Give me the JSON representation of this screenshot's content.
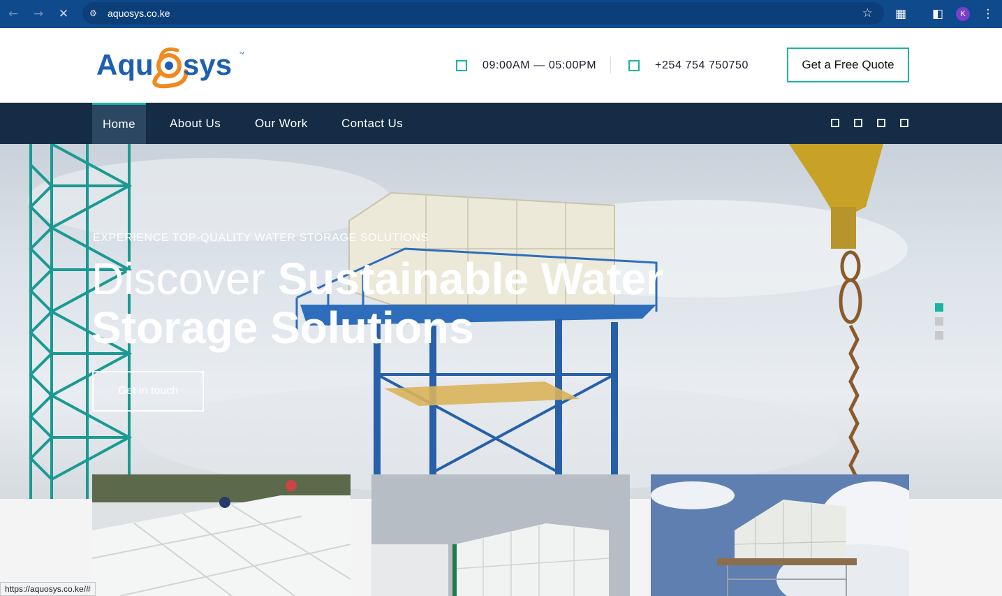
{
  "browser": {
    "url": "aquosys.co.ke",
    "status_url": "https://aquosys.co.ke/#",
    "avatar_letter": "K"
  },
  "header": {
    "logo_text": "Aquosys",
    "logo_tm": "™",
    "hours": "09:00AM — 05:00PM",
    "phone": "+254 754 750750",
    "quote_button": "Get a Free Quote"
  },
  "nav": {
    "items": [
      {
        "label": "Home",
        "active": true
      },
      {
        "label": "About Us",
        "active": false
      },
      {
        "label": "Our Work",
        "active": false
      },
      {
        "label": "Contact Us",
        "active": false
      }
    ]
  },
  "hero": {
    "subtitle": "Experience top-quality water storage solutions",
    "title_light": "Discover ",
    "title_bold": "Sustainable Water Storage Solutions",
    "button": "Get in touch",
    "slides": 3,
    "active_slide": 1
  },
  "colors": {
    "accent": "#1bb3a5",
    "nav_bg": "#142c45",
    "browser_bar": "#0f4a8c"
  }
}
